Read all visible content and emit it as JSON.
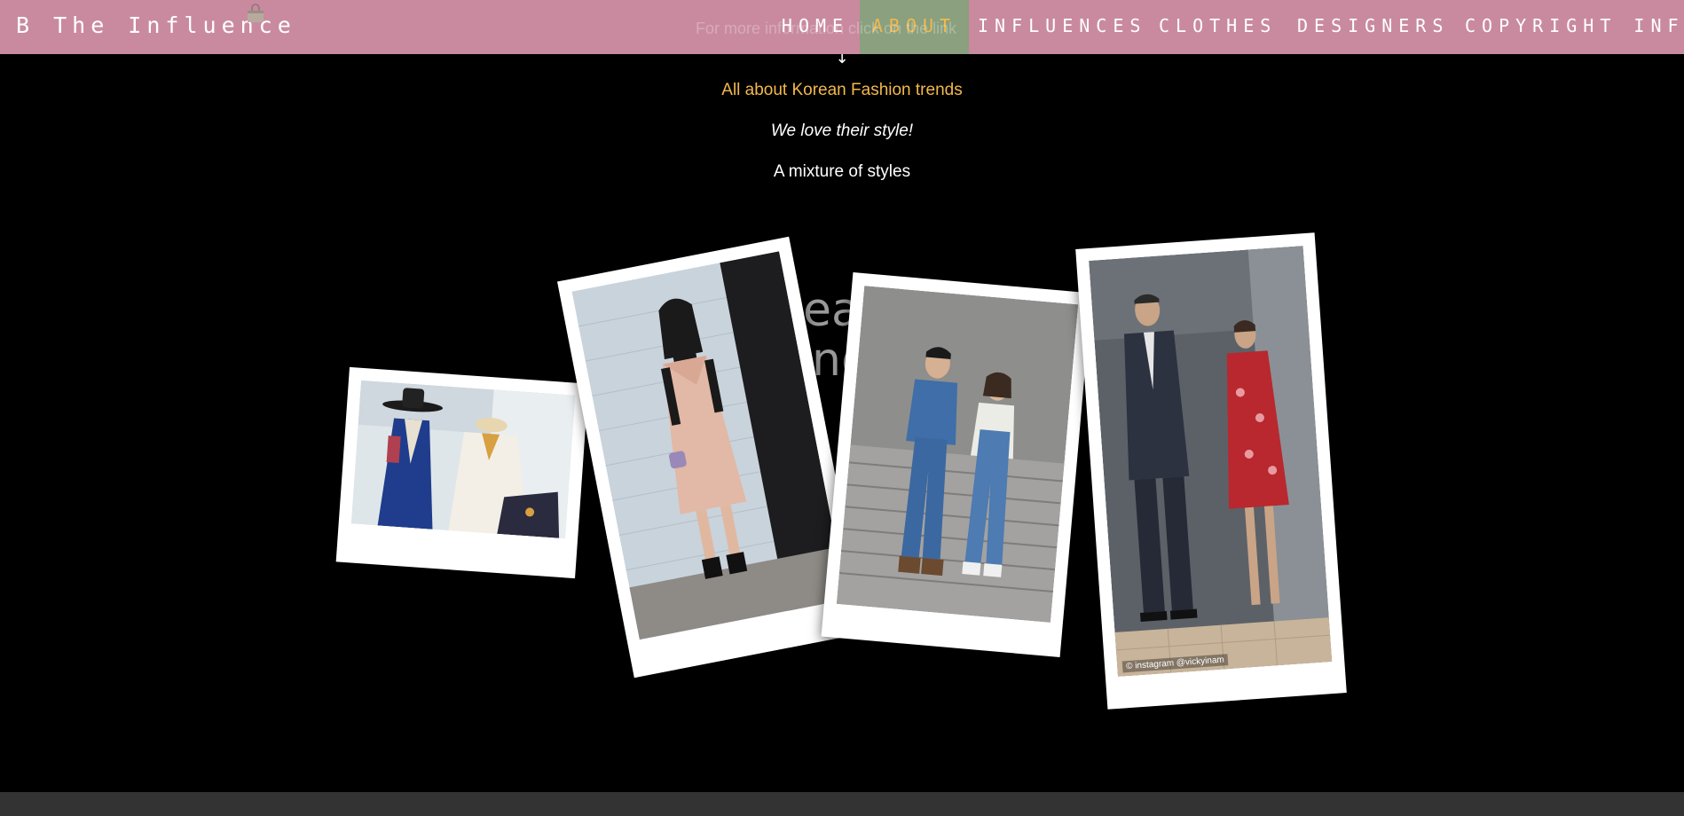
{
  "brand": {
    "name": "B The Influence",
    "icon": "shopping-bag-icon"
  },
  "nav": {
    "items": [
      {
        "label": "HOME",
        "active": false
      },
      {
        "label": "ABOUT",
        "active": true
      },
      {
        "label": "INFLUENCES",
        "active": false
      },
      {
        "label": "CLOTHES",
        "active": false
      },
      {
        "label": "DESIGNERS",
        "active": false
      },
      {
        "label": "COPYRIGHT INFO",
        "active": false
      }
    ]
  },
  "hero": {
    "faded_link": "For more information click on the link",
    "arrow": "↓",
    "headline": "All about Korean Fashion trends",
    "tagline": "We love their style!",
    "subline": "A mixture of styles",
    "bg_word_1": "eat",
    "bg_word_2": "no"
  },
  "gallery": {
    "photos": [
      {
        "subject": "hanbok-mannequins"
      },
      {
        "subject": "woman-pink-dress"
      },
      {
        "subject": "couple-overalls"
      },
      {
        "subject": "mannequins-window",
        "credit": "© instagram @vickyinam"
      }
    ]
  },
  "colors": {
    "nav_bg": "#c98aa0",
    "nav_active_bg": "#8aa07e",
    "accent": "#f3b84b",
    "page_bg": "#000000",
    "footer_bg": "#333333"
  }
}
